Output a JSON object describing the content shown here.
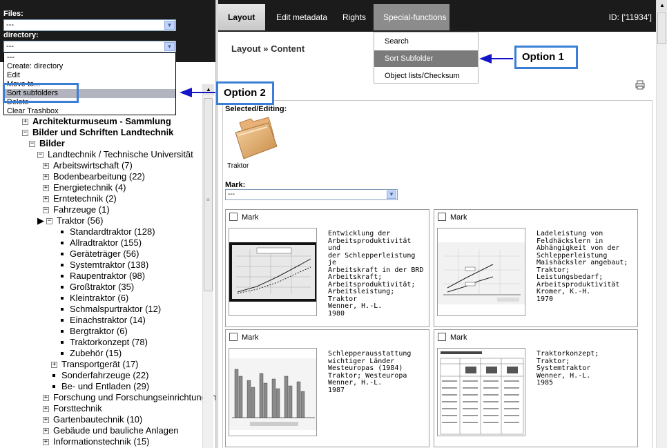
{
  "left": {
    "files_label": "Files:",
    "files_value": "---",
    "directory_label": "directory:",
    "directory_value": "---",
    "directory_options": [
      {
        "label": "---",
        "selected": false
      },
      {
        "label": "Create: directory",
        "selected": false
      },
      {
        "label": "Edit",
        "selected": false
      },
      {
        "label": "Move to...",
        "selected": false
      },
      {
        "label": "Sort subfolders",
        "selected": true
      },
      {
        "label": "Delete",
        "selected": false
      },
      {
        "label": "Clear Trashbox",
        "selected": false
      }
    ],
    "tree": [
      {
        "label": "Architekturmuseum - Sammlung",
        "toggle": "+",
        "bold": true
      },
      {
        "label": "Bilder und Schriften Landtechnik",
        "toggle": "−",
        "bold": true
      },
      {
        "label": "Bilder",
        "toggle": "−",
        "bold": true
      },
      {
        "label": "Landtechnik / Technische Universität",
        "toggle": "−",
        "bold": false
      },
      {
        "label": "Arbeitswirtschaft (7)",
        "toggle": "+",
        "bold": false
      },
      {
        "label": "Bodenbearbeitung (22)",
        "toggle": "+",
        "bold": false
      },
      {
        "label": "Energietechnik (4)",
        "toggle": "+",
        "bold": false
      },
      {
        "label": "Erntetechnik (2)",
        "toggle": "+",
        "bold": false
      },
      {
        "label": "Fahrzeuge (1)",
        "toggle": "−",
        "bold": false
      },
      {
        "label": "Traktor (56)",
        "toggle": "−",
        "bold": false,
        "current": true
      },
      {
        "label": "Standardtraktor (128)",
        "toggle": "bullet",
        "bold": false
      },
      {
        "label": "Allradtraktor (155)",
        "toggle": "bullet",
        "bold": false
      },
      {
        "label": "Geräteträger (56)",
        "toggle": "bullet",
        "bold": false
      },
      {
        "label": "Systemtraktor (138)",
        "toggle": "bullet",
        "bold": false
      },
      {
        "label": "Raupentraktor (98)",
        "toggle": "bullet",
        "bold": false
      },
      {
        "label": "Großtraktor (35)",
        "toggle": "bullet",
        "bold": false
      },
      {
        "label": "Kleintraktor (6)",
        "toggle": "bullet",
        "bold": false
      },
      {
        "label": "Schmalspurtraktor (12)",
        "toggle": "bullet",
        "bold": false
      },
      {
        "label": "Einachstraktor (14)",
        "toggle": "bullet",
        "bold": false
      },
      {
        "label": "Bergtraktor (6)",
        "toggle": "bullet",
        "bold": false
      },
      {
        "label": "Traktorkonzept (78)",
        "toggle": "bullet",
        "bold": false
      },
      {
        "label": "Zubehör (15)",
        "toggle": "bullet",
        "bold": false
      },
      {
        "label": "Transportgerät (17)",
        "toggle": "+",
        "bold": false
      },
      {
        "label": "Sonderfahrzeuge (22)",
        "toggle": "bullet",
        "bold": false
      },
      {
        "label": "Be- und Entladen (29)",
        "toggle": "bullet",
        "bold": false
      },
      {
        "label": "Forschung und Forschungseinrichtungen",
        "toggle": "+",
        "bold": false
      },
      {
        "label": "Forsttechnik",
        "toggle": "+",
        "bold": false
      },
      {
        "label": "Gartenbautechnik (10)",
        "toggle": "+",
        "bold": false
      },
      {
        "label": "Gebäude und bauliche Anlagen",
        "toggle": "+",
        "bold": false
      },
      {
        "label": "Informationstechnik (15)",
        "toggle": "+",
        "bold": false
      }
    ]
  },
  "nav": {
    "tabs": [
      "Layout",
      "Edit metadata",
      "Rights",
      "Special-functions"
    ],
    "id_label": "ID: ['11934']"
  },
  "special_menu": {
    "items": [
      {
        "label": "Search",
        "highlighted": false
      },
      {
        "label": "Sort Subfolder",
        "highlighted": true
      },
      {
        "label": "Object lists/Checksum",
        "highlighted": false
      }
    ]
  },
  "main": {
    "breadcrumb": "Layout » Content",
    "selected_label": "Selected/Editing:",
    "folder_name": "Traktor",
    "mark_label": "Mark:",
    "mark_value": "---",
    "checkbox_label": "Mark",
    "cards": [
      {
        "description": "Entwicklung der\nArbeitsproduktivität und\nder Schlepperleistung je\nArbeitskraft in der BRD\nArbeitskraft;\nArbeitsproduktivität;\nArbeitsleistung; Traktor\nWenner, H.-L.\n1980",
        "thumb": "line-chart-dark"
      },
      {
        "description": "Ladeleistung von\nFeldhäckslern in\nAbhängigkeit von der\nSchlepperleistung\nMaishäcksler angebaut;\nTraktor; Leistungsbedarf;\nArbeitsproduktivität\nKromer, K.-H.\n1970",
        "thumb": "line-chart-light"
      },
      {
        "description": "Schlepperausstattung\nwichtiger Länder\nWesteuropas (1984)\nTraktor; Westeuropa\nWenner, H.-L.\n1987",
        "thumb": "bar-chart"
      },
      {
        "description": "Traktorkonzept; Traktor;\nSystemtraktor\nWenner, H.-L.\n1985",
        "thumb": "table-document"
      }
    ]
  },
  "annotations": {
    "option1": "Option 1",
    "option2": "Option 2",
    "accent_color": "#3a7ed5",
    "arrow_color": "#1414c8"
  }
}
